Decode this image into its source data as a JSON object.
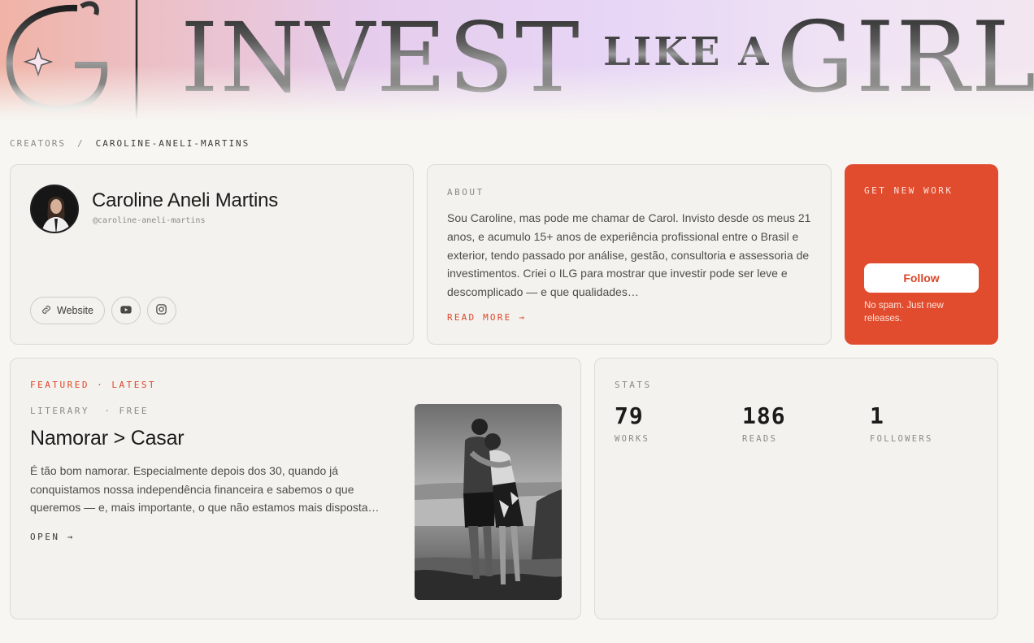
{
  "banner": {
    "monogram": "G",
    "word1": "INVEST",
    "word2": "LIKE A",
    "word3": "GIRL"
  },
  "breadcrumb": {
    "root": "CREATORS",
    "separator": "/",
    "current": "CAROLINE-ANELI-MARTINS"
  },
  "profile": {
    "name": "Caroline Aneli Martins",
    "handle": "@caroline-aneli-martins",
    "links": {
      "website_label": "Website",
      "website_icon": "link-icon",
      "youtube_icon": "youtube-icon",
      "instagram_icon": "instagram-icon"
    }
  },
  "about": {
    "label": "ABOUT",
    "text": "Sou Caroline, mas pode me chamar de Carol. Invisto desde os meus 21 anos, e acumulo 15+ anos de experiência profissional entre o Brasil e exterior, tendo passado por análise, gestão, consultoria e assessoria de investimentos. Criei o ILG para mostrar que investir pode ser leve e descomplicado — e que qualidades…",
    "read_more": "READ MORE →"
  },
  "follow": {
    "label": "GET NEW WORK",
    "button": "Follow",
    "note": "No spam. Just new releases.",
    "accent": "#e24c2e"
  },
  "featured": {
    "tag": "FEATURED · LATEST",
    "meta": "LITERARY  · FREE",
    "title": "Namorar > Casar",
    "description": "É tão bom namorar. Especialmente depois dos 30, quando já conquistamos nossa independência financeira e sabemos o que queremos — e, mais importante, o que não estamos mais disposta…",
    "open": "OPEN →"
  },
  "stats": {
    "label": "STATS",
    "items": [
      {
        "value": "79",
        "label": "WORKS"
      },
      {
        "value": "186",
        "label": "READS"
      },
      {
        "value": "1",
        "label": "FOLLOWERS"
      }
    ]
  }
}
